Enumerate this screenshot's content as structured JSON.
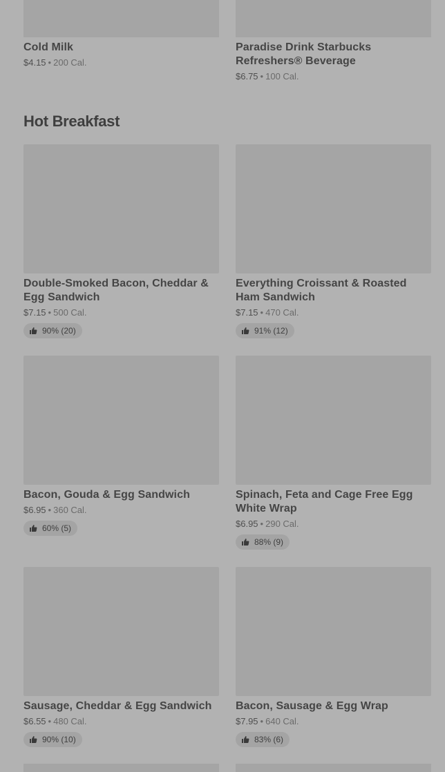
{
  "top_items": [
    {
      "name": "Cold Milk",
      "price": "$4.15",
      "separator": "•",
      "cal": "200 Cal."
    },
    {
      "name": "Paradise Drink Starbucks Refreshers® Beverage",
      "price": "$6.75",
      "separator": "•",
      "cal": "100 Cal."
    }
  ],
  "section": {
    "title": "Hot Breakfast"
  },
  "items": [
    {
      "name": "Double-Smoked Bacon, Cheddar & Egg Sandwich",
      "price": "$7.15",
      "separator": "•",
      "cal": "500 Cal.",
      "rating": "90% (20)"
    },
    {
      "name": "Everything Croissant & Roasted Ham Sandwich",
      "price": "$7.15",
      "separator": "•",
      "cal": "470 Cal.",
      "rating": "91% (12)"
    },
    {
      "name": "Bacon, Gouda & Egg Sandwich",
      "price": "$6.95",
      "separator": "•",
      "cal": "360 Cal.",
      "rating": "60% (5)"
    },
    {
      "name": "Spinach, Feta and Cage Free Egg White Wrap",
      "price": "$6.95",
      "separator": "•",
      "cal": "290 Cal.",
      "rating": "88% (9)"
    },
    {
      "name": "Sausage, Cheddar & Egg Sandwich",
      "price": "$6.55",
      "separator": "•",
      "cal": "480 Cal.",
      "rating": "90% (10)"
    },
    {
      "name": "Bacon, Sausage & Egg Wrap",
      "price": "$7.95",
      "separator": "•",
      "cal": "640 Cal.",
      "rating": "83% (6)"
    }
  ],
  "icons": {
    "rating_icon": "thumbs-up-icon"
  }
}
